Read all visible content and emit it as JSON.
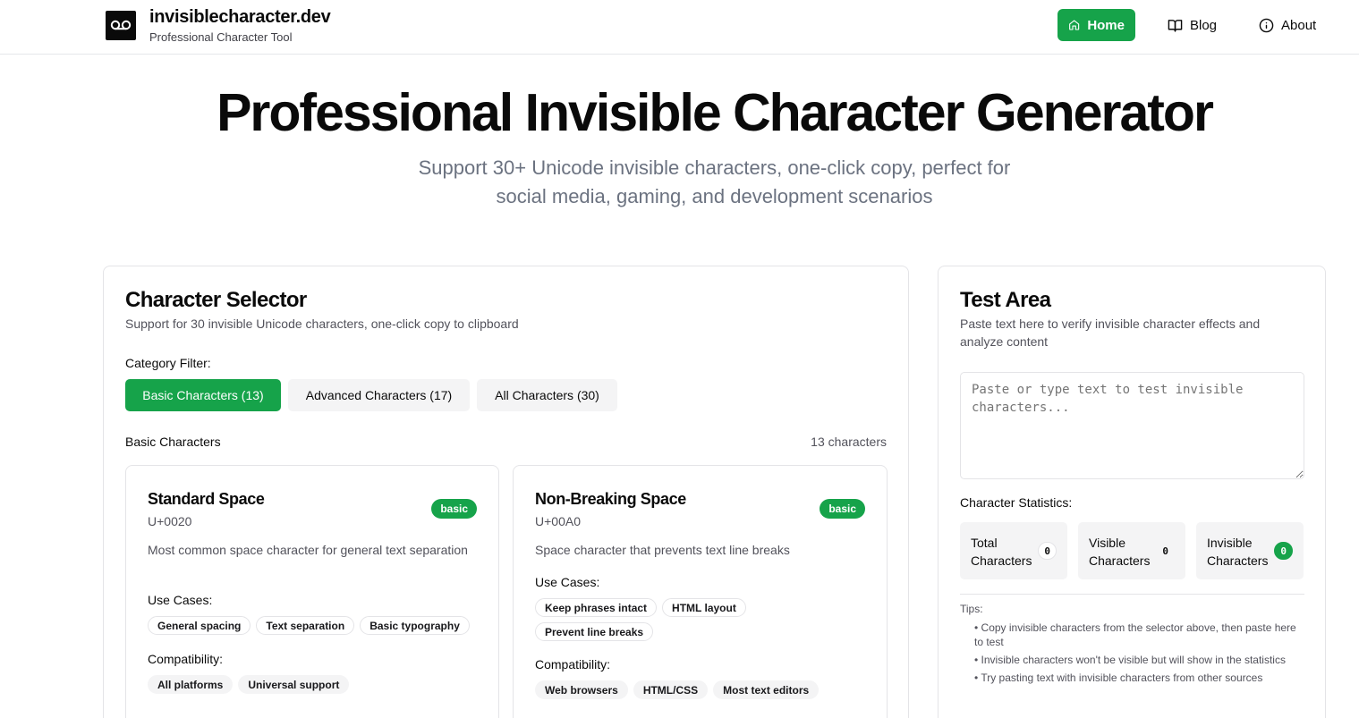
{
  "header": {
    "brand_name": "invisiblecharacter.dev",
    "brand_tagline": "Professional Character Tool",
    "nav": [
      {
        "label": "Home",
        "icon": "home-icon",
        "active": true
      },
      {
        "label": "Blog",
        "icon": "book-icon",
        "active": false
      },
      {
        "label": "About",
        "icon": "info-icon",
        "active": false
      }
    ]
  },
  "hero": {
    "title": "Professional Invisible Character Generator",
    "subtitle": "Support 30+ Unicode invisible characters, one-click copy, perfect for social media, gaming, and development scenarios"
  },
  "selector": {
    "title": "Character Selector",
    "description": "Support for 30 invisible Unicode characters, one-click copy to clipboard",
    "filter_label": "Category Filter:",
    "filters": [
      {
        "label": "Basic Characters (13)",
        "active": true
      },
      {
        "label": "Advanced Characters (17)",
        "active": false
      },
      {
        "label": "All Characters (30)",
        "active": false
      }
    ],
    "section_name": "Basic Characters",
    "section_count": "13 characters",
    "use_cases_label": "Use Cases:",
    "compat_label": "Compatibility:",
    "cards": [
      {
        "name": "Standard Space",
        "code": "U+0020",
        "badge": "basic",
        "description": "Most common space character for general text separation",
        "use_cases": [
          "General spacing",
          "Text separation",
          "Basic typography"
        ],
        "compatibility": [
          "All platforms",
          "Universal support"
        ]
      },
      {
        "name": "Non-Breaking Space",
        "code": "U+00A0",
        "badge": "basic",
        "description": "Space character that prevents text line breaks",
        "use_cases": [
          "Keep phrases intact",
          "HTML layout",
          "Prevent line breaks"
        ],
        "compatibility": [
          "Web browsers",
          "HTML/CSS",
          "Most text editors"
        ]
      }
    ]
  },
  "test_area": {
    "title": "Test Area",
    "description": "Paste text here to verify invisible character effects and analyze content",
    "placeholder": "Paste or type text to test invisible characters...",
    "stats_label": "Character Statistics:",
    "stats": [
      {
        "label": "Total Characters",
        "value": "0"
      },
      {
        "label": "Visible Characters",
        "value": "0"
      },
      {
        "label": "Invisible Characters",
        "value": "0"
      }
    ],
    "tips_title": "Tips:",
    "tips": [
      "• Copy invisible characters from the selector above, then paste here to test",
      "• Invisible characters won't be visible but will show in the statistics",
      "• Try pasting text with invisible characters from other sources"
    ]
  },
  "colors": {
    "accent": "#16a34a",
    "text": "#0a0a0a",
    "muted": "#52525b",
    "border": "#e4e4e7"
  }
}
